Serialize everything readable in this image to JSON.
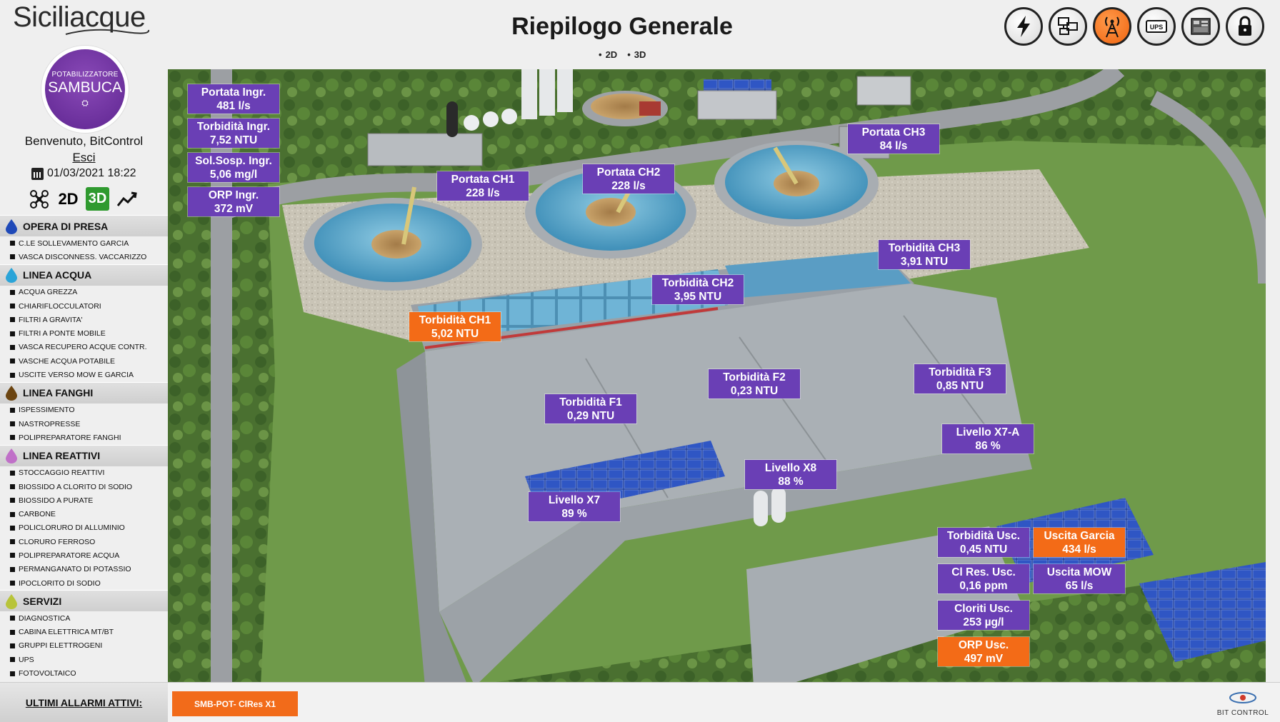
{
  "header": {
    "brand": "Siciliacque",
    "title": "Riepilogo Generale",
    "view_2d": "2D",
    "view_3d": "3D",
    "top_icons": [
      "power-icon",
      "network-icon",
      "antenna-icon",
      "ups-icon",
      "plc-icon",
      "lock-icon"
    ]
  },
  "sidebar": {
    "plant_logo": {
      "line1": "POTABILIZZATORE",
      "line2": "SAMBUCA"
    },
    "welcome": "Benvenuto, BitControl",
    "logout": "Esci",
    "datetime": "01/03/2021 18:22",
    "view_buttons": {
      "b2d": "2D",
      "b3d": "3D"
    },
    "sections": [
      {
        "label": "OPERA DI PRESA",
        "color": "#1f49b8",
        "items": [
          "C.LE SOLLEVAMENTO GARCIA",
          "VASCA DISCONNESS. VACCARIZZO"
        ]
      },
      {
        "label": "LINEA ACQUA",
        "color": "#2aa4d8",
        "items": [
          "ACQUA GREZZA",
          "CHIARIFLOCCULATORI",
          "FILTRI A GRAVITA'",
          "FILTRI A PONTE MOBILE",
          "VASCA RECUPERO ACQUE CONTR.",
          "VASCHE ACQUA POTABILE",
          "USCITE VERSO MOW E GARCIA"
        ]
      },
      {
        "label": "LINEA FANGHI",
        "color": "#6b4410",
        "items": [
          "ISPESSIMENTO",
          "NASTROPRESSE",
          "POLIPREPARATORE FANGHI"
        ]
      },
      {
        "label": "LINEA REATTIVI",
        "color": "#c070c8",
        "items": [
          "STOCCAGGIO REATTIVI",
          "BIOSSIDO A CLORITO DI SODIO",
          "BIOSSIDO A PURATE",
          "CARBONE",
          "POLICLORURO DI ALLUMINIO",
          "CLORURO FERROSO",
          "POLIPREPARATORE ACQUA",
          "PERMANGANATO DI POTASSIO",
          "IPOCLORITO DI SODIO"
        ]
      },
      {
        "label": "SERVIZI",
        "color": "#b8c43a",
        "items": [
          "DIAGNOSTICA",
          "CABINA ELETTRICA MT/BT",
          "GRUPPI ELETTROGENI",
          "UPS",
          "FOTOVOLTAICO"
        ]
      }
    ]
  },
  "tags": [
    {
      "name": "Portata Ingr.",
      "value": "481 l/s",
      "status": "normal"
    },
    {
      "name": "Torbidità Ingr.",
      "value": "7,52 NTU",
      "status": "normal"
    },
    {
      "name": "Sol.Sosp. Ingr.",
      "value": "5,06 mg/l",
      "status": "normal"
    },
    {
      "name": "ORP Ingr.",
      "value": "372 mV",
      "status": "normal"
    },
    {
      "name": "Portata CH1",
      "value": "228 l/s",
      "status": "normal"
    },
    {
      "name": "Portata CH2",
      "value": "228 l/s",
      "status": "normal"
    },
    {
      "name": "Portata CH3",
      "value": "84 l/s",
      "status": "normal"
    },
    {
      "name": "Torbidità CH3",
      "value": "3,91 NTU",
      "status": "normal"
    },
    {
      "name": "Torbidità CH2",
      "value": "3,95 NTU",
      "status": "normal"
    },
    {
      "name": "Torbidità CH1",
      "value": "5,02 NTU",
      "status": "alarm"
    },
    {
      "name": "Torbidità F2",
      "value": "0,23 NTU",
      "status": "normal"
    },
    {
      "name": "Torbidità F3",
      "value": "0,85 NTU",
      "status": "normal"
    },
    {
      "name": "Torbidità F1",
      "value": "0,29 NTU",
      "status": "normal"
    },
    {
      "name": "Livello X7-A",
      "value": "86 %",
      "status": "normal"
    },
    {
      "name": "Livello X8",
      "value": "88 %",
      "status": "normal"
    },
    {
      "name": "Livello X7",
      "value": "89 %",
      "status": "normal"
    },
    {
      "name": "Torbidità Usc.",
      "value": "0,45 NTU",
      "status": "normal"
    },
    {
      "name": "Uscita Garcia",
      "value": "434 l/s",
      "status": "alarm"
    },
    {
      "name": "Cl Res. Usc.",
      "value": "0,16 ppm",
      "status": "normal"
    },
    {
      "name": "Uscita MOW",
      "value": "65 l/s",
      "status": "normal"
    },
    {
      "name": "Cloriti Usc.",
      "value": "253 µg/l",
      "status": "normal"
    },
    {
      "name": "ORP Usc.",
      "value": "497 mV",
      "status": "alarm"
    }
  ],
  "alarms": {
    "label": "ULTIMI ALLARMI ATTIVI:",
    "active": [
      "SMB-POT- ClRes X1"
    ]
  },
  "vendor": "BIT CONTROL",
  "colors": {
    "tag_normal": "#6a3fb5",
    "tag_alarm": "#f36b17",
    "accent_3d": "#2f9a2f"
  }
}
